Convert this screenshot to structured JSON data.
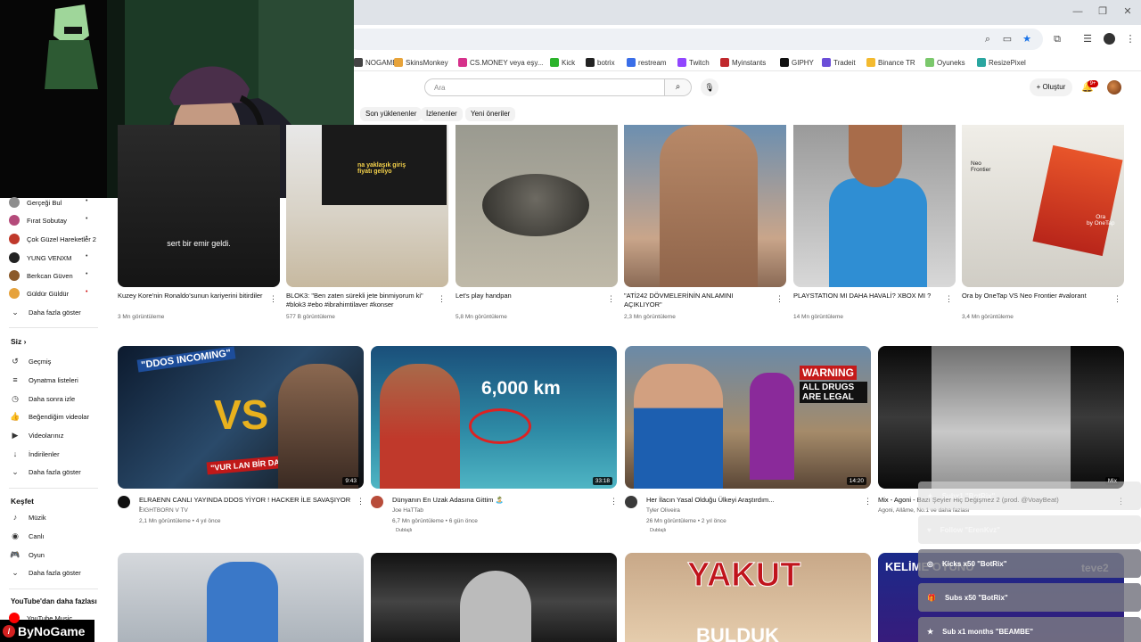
{
  "bookmarks": [
    {
      "label": "NOGAME",
      "color": "#444"
    },
    {
      "label": "SkinsMonkey",
      "color": "#e7a33a"
    },
    {
      "label": "CS.MONEY veya eşy...",
      "color": "#d6318b"
    },
    {
      "label": "Kick",
      "color": "#2bb32b"
    },
    {
      "label": "botrix",
      "color": "#222"
    },
    {
      "label": "restream",
      "color": "#3a6ee8"
    },
    {
      "label": "Twitch",
      "color": "#9146ff"
    },
    {
      "label": "Myinstants",
      "color": "#c0282d"
    },
    {
      "label": "GIPHY",
      "color": "#111"
    },
    {
      "label": "Tradeit",
      "color": "#6b4ed8"
    },
    {
      "label": "Binance TR",
      "color": "#f3ba2f"
    },
    {
      "label": "Oyuneks",
      "color": "#7bc86c"
    },
    {
      "label": "ResizePixel",
      "color": "#2aa6a0"
    }
  ],
  "header": {
    "search_placeholder": "Ara",
    "create_label": "Oluştur",
    "notif_count": "9+"
  },
  "chips": [
    "Son yüklenenler",
    "İzlenenler",
    "Yeni öneriler"
  ],
  "sidebar": {
    "subs": [
      {
        "label": "Gerçeği Bul",
        "color": "#8e8e8e"
      },
      {
        "label": "Fırat Sobutay",
        "color": "#b44a7a"
      },
      {
        "label": "Çok Güzel Hareketler 2",
        "color": "#c0392b"
      },
      {
        "label": "YUNG VENXM",
        "color": "#222"
      },
      {
        "label": "Berkcan Güven",
        "color": "#8b5a2b"
      },
      {
        "label": "Güldür Güldür",
        "color": "#e6a23c"
      }
    ],
    "show_more": "Daha fazla göster",
    "you_title": "Siz",
    "you_items": [
      {
        "label": "Geçmiş",
        "icon": "history-icon",
        "glyph": "↺"
      },
      {
        "label": "Oynatma listeleri",
        "icon": "playlists-icon",
        "glyph": "≡"
      },
      {
        "label": "Daha sonra izle",
        "icon": "watch-later-icon",
        "glyph": "◷"
      },
      {
        "label": "Beğendiğim videolar",
        "icon": "like-icon",
        "glyph": "👍"
      },
      {
        "label": "Videolarınız",
        "icon": "your-videos-icon",
        "glyph": "▶"
      },
      {
        "label": "İndirilenler",
        "icon": "download-icon",
        "glyph": "↓"
      }
    ],
    "explore_title": "Keşfet",
    "explore_items": [
      {
        "label": "Müzik",
        "icon": "music-icon",
        "glyph": "♪"
      },
      {
        "label": "Canlı",
        "icon": "live-icon",
        "glyph": "◉"
      },
      {
        "label": "Oyun",
        "icon": "gaming-icon",
        "glyph": "🎮"
      }
    ],
    "more_title": "YouTube'dan daha fazlası",
    "music_label": "YouTube Music"
  },
  "row1": [
    {
      "title": "Kuzey Kore'nin Ronaldo'sunun kariyerini bitirdiler",
      "meta": "3 Mn görüntüleme",
      "overlay": "sert bir emir geldi."
    },
    {
      "title": "BLOK3: \"Ben zaten sürekli jete binmiyorum ki\" #blok3 #ebo #ibrahimtilaver #konser",
      "meta": "577 B görüntüleme",
      "overlay": "na yaklaşık giriş\nfiyatı geliyo"
    },
    {
      "title": "Let's play handpan",
      "meta": "5,8 Mn görüntüleme",
      "overlay": ""
    },
    {
      "title": "\"ATİ242 DÖVMELERİNİN ANLAMINI AÇIKLIYOR\"",
      "meta": "2,3 Mn görüntüleme",
      "overlay": ""
    },
    {
      "title": "PLAYSTATION MI DAHA HAVALİ? XBOX MI ?",
      "meta": "14 Mn görüntüleme",
      "overlay": ""
    },
    {
      "title": "Ora by OneTap VS Neo Frontier #valorant",
      "meta": "3,4 Mn görüntüleme",
      "overlay": "Neo\nFrontier",
      "overlay2": "Ora\nby OneTap"
    }
  ],
  "row2": [
    {
      "title": "ELRAENN CANLI YAYINDA DDOS YİYOR ! HACKER İLE SAVAŞIYOR !",
      "channel": "EIGHTBORN V TV",
      "meta": "2,1 Mn görüntüleme • 4 yıl önce",
      "duration": "9:43",
      "badge": "",
      "t1": "\"DDOS INCOMING\"",
      "t2": "VS",
      "t3": "\"VUR LAN BİR DAHA VUR\""
    },
    {
      "title": "Dünyanın En Uzak Adasına Gittim 🏝️",
      "channel": "Joe HaTTab",
      "meta": "6,7 Mn görüntüleme • 6 gün önce",
      "duration": "33:18",
      "badge": "Dublajlı",
      "t1": "6,000 km"
    },
    {
      "title": "Her İlacın Yasal Olduğu Ülkeyi Araştırdım...",
      "channel": "Tyler Oliveira",
      "meta": "26 Mn görüntüleme • 2 yıl önce",
      "duration": "14:20",
      "badge": "Dublajlı",
      "t1": "WARNING",
      "t2": "ALL DRUGS ARE LEGAL"
    },
    {
      "title": "Mix - Agoni - Bazı Şeyler Hiç Değişmez 2 (prod. @VoayBeat)",
      "channel": "Agoni, Allâme, No.1 ve daha fazlası",
      "meta": "",
      "duration": "Mix",
      "badge": ""
    }
  ],
  "row3": [
    {
      "t1": ""
    },
    {
      "t1": ""
    },
    {
      "t1": "YAKUT",
      "t2": "BULDUK"
    },
    {
      "t1": "KELİME OYUNU",
      "t2": "teve2"
    }
  ],
  "overlay_events": [
    {
      "text": "Subx1 \"BotRix\"",
      "icon": "gift-icon",
      "glyph": "✦",
      "faded": true
    },
    {
      "text": "Follow \"ErenKvz\"",
      "icon": "heart-icon",
      "glyph": "♥",
      "faded": true
    },
    {
      "text": "Kicks x50 \"BotRix\"",
      "icon": "kick-icon",
      "glyph": "◎",
      "faded": false
    },
    {
      "text": "Subs x50 \"BotRix\"",
      "icon": "gift-icon",
      "glyph": "🎁",
      "faded": false
    },
    {
      "text": "Sub x1 months \"BEAMBE\"",
      "icon": "star-icon",
      "glyph": "★",
      "faded": false
    }
  ],
  "brand": "ByNoGame"
}
